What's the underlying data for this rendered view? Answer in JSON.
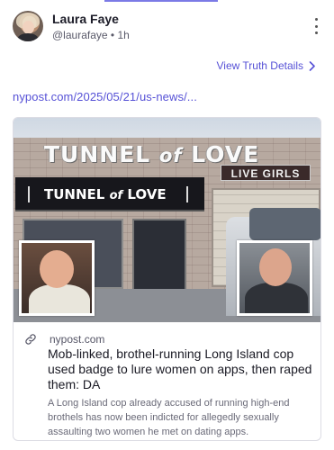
{
  "post": {
    "author_name": "Laura Faye",
    "handle": "@laurafaye",
    "separator": "•",
    "time_ago": "1h",
    "truth_details_label": "View Truth Details",
    "url_text": "nypost.com/2025/05/21/us-news/..."
  },
  "card": {
    "image_signs": {
      "roof_sign_main": "TUNNEL",
      "roof_sign_of": "of",
      "roof_sign_end": "LOVE",
      "awning_main": "TUNNEL",
      "awning_of": "of",
      "awning_end": "LOVE",
      "live_girls": "LIVE GIRLS"
    },
    "source": "nypost.com",
    "headline": "Mob-linked, brothel-running Long Island cop used badge to lure women on apps, then raped them: DA",
    "description": "A Long Island cop already accused of running high-end brothels has now been indicted for allegedly sexually assaulting two women he met on dating apps."
  },
  "colors": {
    "accent": "#5651d6",
    "text_primary": "#1a1a24",
    "text_secondary": "#6a6a78",
    "card_border": "#dcdce4"
  },
  "icons": {
    "more": "kebab-menu-icon",
    "chevron": "chevron-right-icon",
    "link": "link-icon"
  }
}
